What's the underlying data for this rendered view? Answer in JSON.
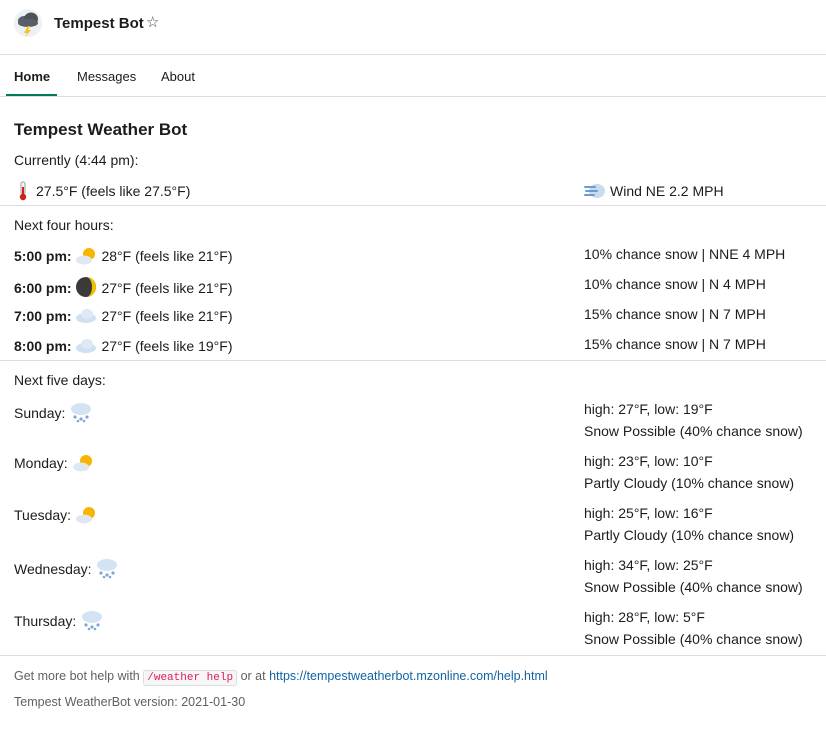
{
  "header": {
    "bot_name": "Tempest Bot",
    "star_icon": "star-outline-icon"
  },
  "tabs": [
    {
      "label": "Home",
      "active": true
    },
    {
      "label": "Messages",
      "active": false
    },
    {
      "label": "About",
      "active": false
    }
  ],
  "main": {
    "title": "Tempest Weather Bot",
    "current": {
      "heading": "Currently (4:44 pm):",
      "temp": "27.5°F (feels like 27.5°F)",
      "wind": "Wind NE 2.2 MPH"
    },
    "hourly": {
      "heading": "Next four hours:",
      "rows": [
        {
          "time": "5:00 pm:",
          "icon": "partly-cloudy-icon",
          "temp": "28°F (feels like 21°F)",
          "detail": "10% chance snow | NNE 4 MPH"
        },
        {
          "time": "6:00 pm:",
          "icon": "moon-icon",
          "temp": "27°F (feels like 21°F)",
          "detail": "10% chance snow | N 4 MPH"
        },
        {
          "time": "7:00 pm:",
          "icon": "cloud-icon",
          "temp": "27°F (feels like 21°F)",
          "detail": "15% chance snow | N 7 MPH"
        },
        {
          "time": "8:00 pm:",
          "icon": "cloud-icon",
          "temp": "27°F (feels like 19°F)",
          "detail": "15% chance snow | N 7 MPH"
        }
      ]
    },
    "daily": {
      "heading": "Next five days:",
      "rows": [
        {
          "day": "Sunday:",
          "icon": "snow-cloud-icon",
          "hilo": "high: 27°F, low: 19°F",
          "summary": "Snow Possible (40% chance snow)"
        },
        {
          "day": "Monday:",
          "icon": "partly-cloudy-icon",
          "hilo": "high: 23°F, low: 10°F",
          "summary": "Partly Cloudy (10% chance snow)"
        },
        {
          "day": "Tuesday:",
          "icon": "partly-cloudy-icon",
          "hilo": "high: 25°F, low: 16°F",
          "summary": "Partly Cloudy (10% chance snow)"
        },
        {
          "day": "Wednesday:",
          "icon": "snow-cloud-icon",
          "hilo": "high: 34°F, low: 25°F",
          "summary": "Snow Possible (40% chance snow)"
        },
        {
          "day": "Thursday:",
          "icon": "snow-cloud-icon",
          "hilo": "high: 28°F, low: 5°F",
          "summary": "Snow Possible (40% chance snow)"
        }
      ]
    }
  },
  "footer": {
    "help_prefix": "Get more bot help with",
    "help_command": "/weather help",
    "help_middle": "or at",
    "help_link": "https://tempestweatherbot.mzonline.com/help.html",
    "version": "Tempest WeatherBot version: 2021-01-30"
  },
  "colors": {
    "accent": "#007a5a",
    "link": "#1264a3",
    "code": "#e01e5a"
  }
}
